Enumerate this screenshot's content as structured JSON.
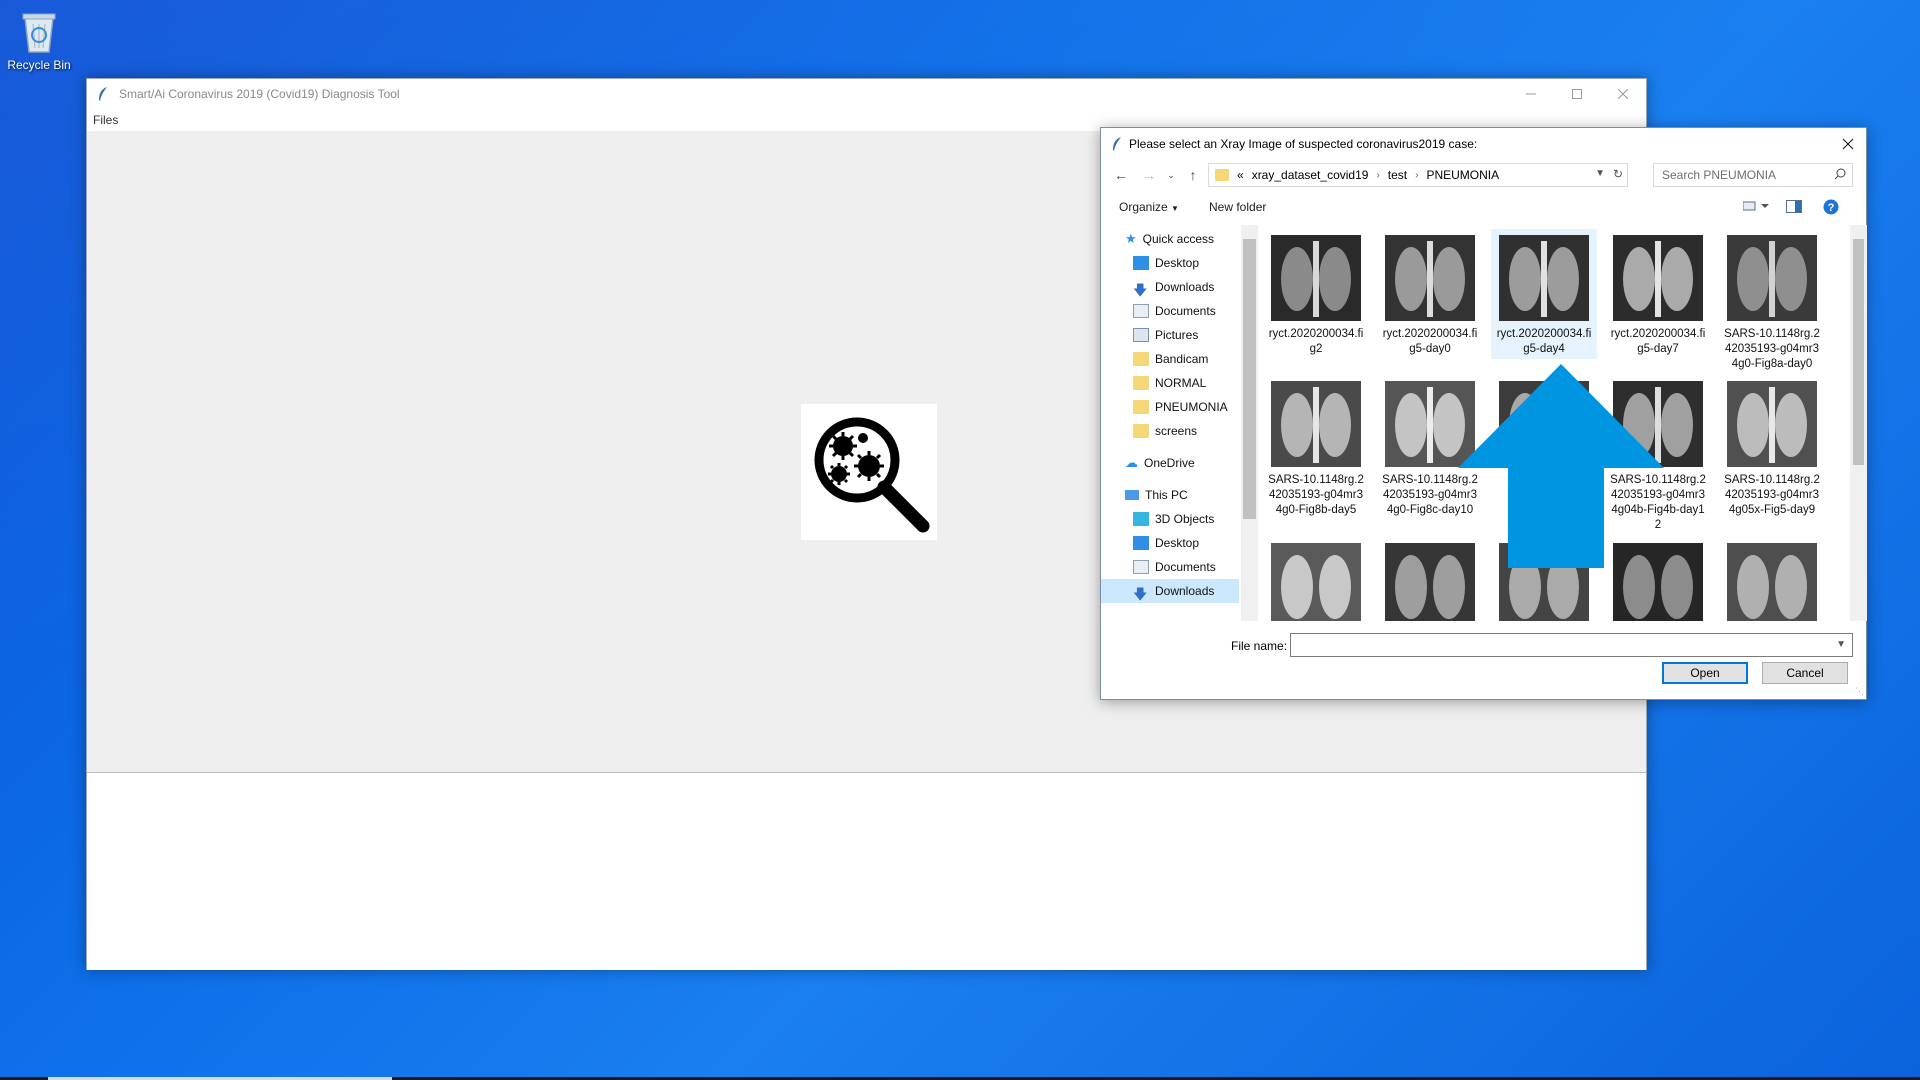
{
  "desktop": {
    "recycle_bin_label": "Recycle Bin"
  },
  "app": {
    "title": "Smart/Ai Coronavirus 2019 (Covid19) Diagnosis Tool",
    "menu": {
      "files": "Files"
    }
  },
  "dialog": {
    "title": "Please select an Xray Image of suspected coronavirus2019 case:",
    "breadcrumb": [
      "xray_dataset_covid19",
      "test",
      "PNEUMONIA"
    ],
    "breadcrumb_prefix": "«",
    "search_placeholder": "Search PNEUMONIA",
    "toolbar": {
      "organize": "Organize",
      "new_folder": "New folder"
    },
    "nav": {
      "quick_access": "Quick access",
      "desktop": "Desktop",
      "downloads": "Downloads",
      "documents": "Documents",
      "pictures": "Pictures",
      "bandicam": "Bandicam",
      "normal": "NORMAL",
      "pneumonia": "PNEUMONIA",
      "screens": "screens",
      "onedrive": "OneDrive",
      "this_pc": "This PC",
      "objects3d": "3D Objects",
      "desktop2": "Desktop",
      "documents2": "Documents",
      "downloads2": "Downloads"
    },
    "files": [
      "ryct.2020200034.fig2",
      "ryct.2020200034.fig5-day0",
      "ryct.2020200034.fig5-day4",
      "ryct.2020200034.fig5-day7",
      "SARS-10.1148rg.242035193-g04mr34g0-Fig8a-day0",
      "SARS-10.1148rg.242035193-g04mr34g0-Fig8b-day5",
      "SARS-10.1148rg.242035193-g04mr34g0-Fig8c-day10",
      "",
      "SARS-10.1148rg.242035193-g04mr34g04b-Fig4b-day12",
      "SARS-10.1148rg.242035193-g04mr34g05x-Fig5-day9"
    ],
    "file_name_label": "File name:",
    "file_name_value": "",
    "open_label": "Open",
    "cancel_label": "Cancel"
  },
  "colors": {
    "accent": "#0078d7",
    "arrow": "#0095e0",
    "selection": "#cce8ff"
  }
}
